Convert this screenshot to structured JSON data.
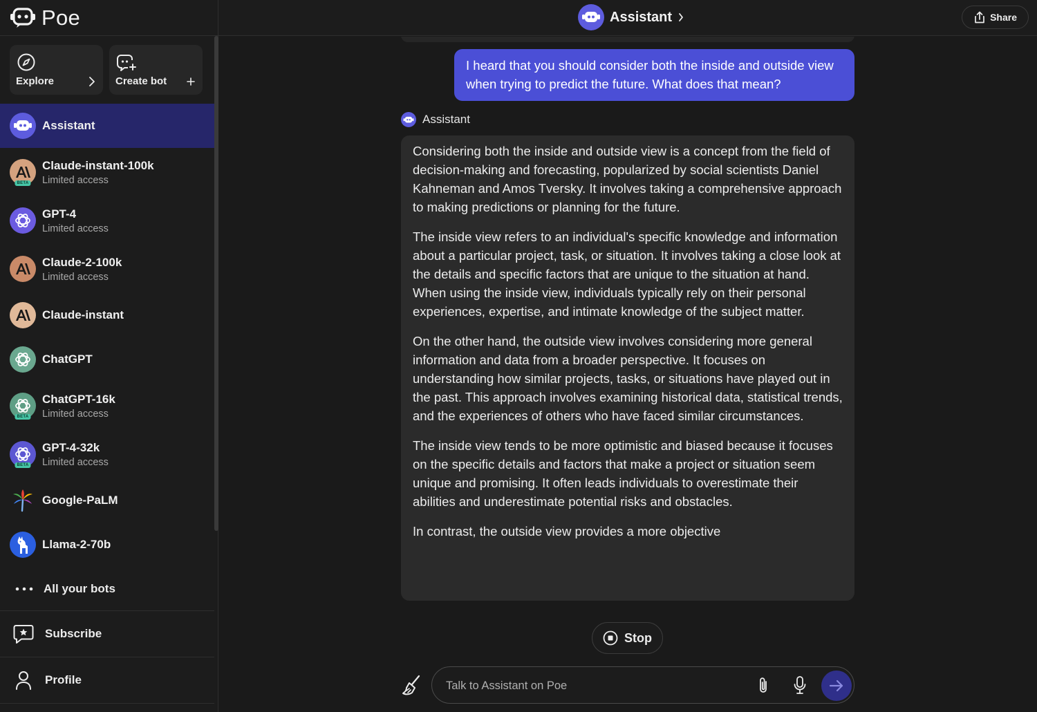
{
  "app": {
    "name": "Poe"
  },
  "sidebar": {
    "explore_label": "Explore",
    "create_bot_label": "Create bot",
    "bots": [
      {
        "name": "Assistant",
        "sub": ""
      },
      {
        "name": "Claude-instant-100k",
        "sub": "Limited access",
        "badge": "BETA"
      },
      {
        "name": "GPT-4",
        "sub": "Limited access"
      },
      {
        "name": "Claude-2-100k",
        "sub": "Limited access"
      },
      {
        "name": "Claude-instant",
        "sub": ""
      },
      {
        "name": "ChatGPT",
        "sub": ""
      },
      {
        "name": "ChatGPT-16k",
        "sub": "Limited access",
        "badge": "BETA"
      },
      {
        "name": "GPT-4-32k",
        "sub": "Limited access",
        "badge": "BETA"
      },
      {
        "name": "Google-PaLM",
        "sub": ""
      },
      {
        "name": "Llama-2-70b",
        "sub": ""
      }
    ],
    "all_bots_label": "All your bots",
    "subscribe_label": "Subscribe",
    "profile_label": "Profile"
  },
  "topbar": {
    "title": "Assistant",
    "share_label": "Share"
  },
  "chat": {
    "user_message": "I heard that you should consider both the inside and outside view when trying to predict the future. What does that mean?",
    "assistant_name": "Assistant",
    "assistant_paragraphs": [
      "Considering both the inside and outside view is a concept from the field of decision-making and forecasting, popularized by social scientists Daniel Kahneman and Amos Tversky. It involves taking a comprehensive approach to making predictions or planning for the future.",
      "The inside view refers to an individual's specific knowledge and information about a particular project, task, or situation. It involves taking a close look at the details and specific factors that are unique to the situation at hand. When using the inside view, individuals typically rely on their personal experiences, expertise, and intimate knowledge of the subject matter.",
      "On the other hand, the outside view involves considering more general information and data from a broader perspective. It focuses on understanding how similar projects, tasks, or situations have played out in the past. This approach involves examining historical data, statistical trends, and the experiences of others who have faced similar circumstances.",
      "The inside view tends to be more optimistic and biased because it focuses on the specific details and factors that make a project or situation seem unique and promising. It often leads individuals to overestimate their abilities and underestimate potential risks and obstacles.",
      "In contrast, the outside view provides a more objective"
    ],
    "stop_label": "Stop",
    "input_placeholder": "Talk to Assistant on Poe"
  },
  "colors": {
    "accent": "#4b4fd6",
    "active_bot_bg": "#26266a",
    "send_button": "#2f2f8a"
  }
}
